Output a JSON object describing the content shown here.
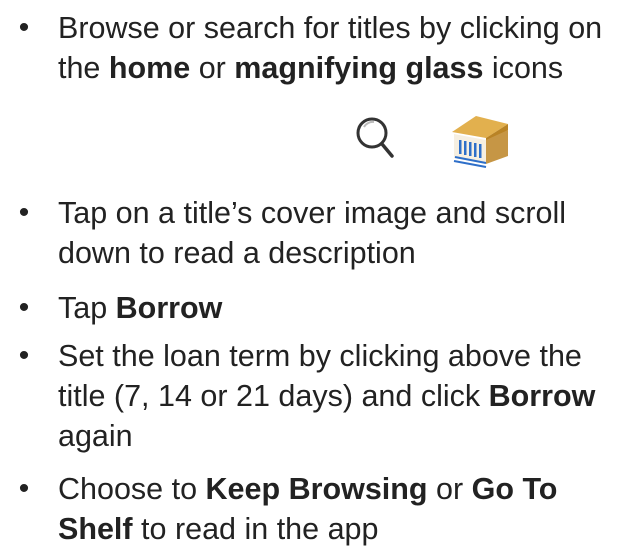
{
  "instructions": [
    {
      "parts": [
        {
          "text": "Browse or search for titles by clicking on the ",
          "bold": false
        },
        {
          "text": "home",
          "bold": true
        },
        {
          "text": " or ",
          "bold": false
        },
        {
          "text": "magnifying glass",
          "bold": true
        },
        {
          "text": " icons",
          "bold": false
        }
      ]
    },
    {
      "parts": [
        {
          "text": "Tap on a title’s cover image and scroll down to read a  description",
          "bold": false
        }
      ]
    },
    {
      "parts": [
        {
          "text": "Tap ",
          "bold": false
        },
        {
          "text": "Borrow",
          "bold": true
        }
      ]
    },
    {
      "parts": [
        {
          "text": "Set the loan term by clicking above the title (7, 14 or 21 days) and click ",
          "bold": false
        },
        {
          "text": "Borrow",
          "bold": true
        },
        {
          "text": " again",
          "bold": false
        }
      ]
    },
    {
      "parts": [
        {
          "text": "Choose to ",
          "bold": false
        },
        {
          "text": "Keep Browsing",
          "bold": true
        },
        {
          "text": " or ",
          "bold": false
        },
        {
          "text": "Go To Shelf",
          "bold": true
        },
        {
          "text": " to read in the app",
          "bold": false
        }
      ]
    }
  ],
  "icons": {
    "search": "magnifying-glass-icon",
    "home": "library-building-icon",
    "home_roof_color": "#d9a441",
    "home_accent_color": "#2e6fc9"
  }
}
